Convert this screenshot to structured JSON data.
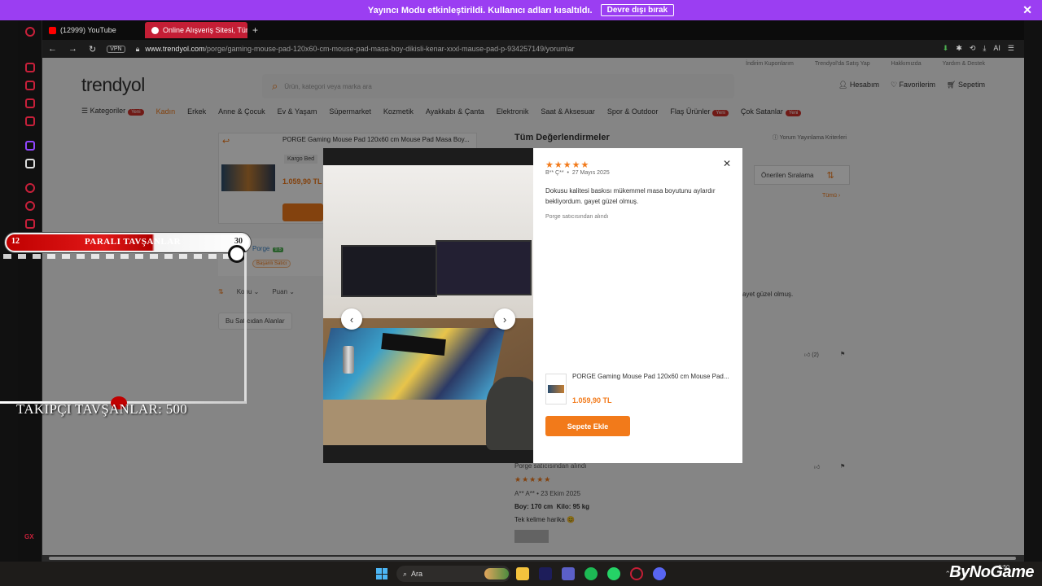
{
  "banner": {
    "text": "Yayıncı Modu etkinleştirildi. Kullanıcı adları kısaltıldı.",
    "button": "Devre dışı bırak",
    "close": "✕"
  },
  "tabs": [
    {
      "label": "(12999) YouTube"
    },
    {
      "label": "Online Alışveriş Sitesi, Tür"
    }
  ],
  "addtab": "+",
  "url": {
    "vpn": "VPN",
    "host": "www.trendyol.com",
    "path": "/porge/gaming-mouse-pad-120x60-cm-mouse-pad-masa-boy-dikisli-kenar-xxxl-mause-pad-p-934257149/yorumlar"
  },
  "toolbar": {
    "ai": "AI"
  },
  "site": {
    "topstrip": [
      "İndirim Kuponlarım",
      "Trendyol'da Satış Yap",
      "Hakkımızda",
      "Yardım & Destek"
    ],
    "logo": "trendyol",
    "search_placeholder": "Ürün, kategori veya marka ara",
    "account": {
      "login": "Hesabım",
      "fav": "Favorilerim",
      "cart": "Sepetim"
    },
    "nav": [
      "Kategoriler",
      "Kadın",
      "Erkek",
      "Anne & Çocuk",
      "Ev & Yaşam",
      "Süpermarket",
      "Kozmetik",
      "Ayakkabı & Çanta",
      "Elektronik",
      "Saat & Aksesuar",
      "Spor & Outdoor",
      "Flaş Ürünler",
      "Çok Satanlar"
    ],
    "yeni": "Yeni",
    "product": {
      "title": "PORGE Gaming Mouse Pad 120x60 cm Mouse Pad Masa Boy...",
      "cargo": "Kargo Bed",
      "price": "1.059,90 TL"
    },
    "seller": {
      "name": "Porge",
      "score": "9.6",
      "badge": "Başarılı Satıcı"
    },
    "filters": [
      "Konu",
      "Puan"
    ],
    "tag": "Bu Satıcıdan Alanlar",
    "reviews_title": "Tüm Değerlendirmeler",
    "criteria": "Yorum Yayınlama Kriterleri",
    "sort": "Önerilen Sıralama",
    "all": "Tümü",
    "bg_review_text": "ayet güzel olmuş.",
    "likes": "(2)",
    "review2": {
      "seller": "Porge satıcısından alındı",
      "stars": "★★★★★",
      "user": "A** A**",
      "date": "23 Ekim 2025",
      "height": "Boy: 170 cm",
      "weight": "Kilo: 95 kg",
      "text": "Tek kelime harika 😊"
    }
  },
  "modal": {
    "stars": "★★★★★",
    "user": "B** Ç**",
    "date": "27 Mayıs 2025",
    "text": "Dokusu kalitesi baskısı mükemmel masa boyutunu aylardır bekliyordum. gayet güzel olmuş.",
    "seller": "Porge satıcısından alındı",
    "product_title": "PORGE Gaming Mouse Pad 120x60 cm Mouse Pad...",
    "price": "1.059,90 TL",
    "cart_button": "Sepete Ekle",
    "prev": "‹",
    "next": "›",
    "close": "✕"
  },
  "stream": {
    "left": "12",
    "title": "PARALI TAVŞANLAR",
    "right": "30",
    "followers": "TAKIPÇI TAVŞANLAR: 500"
  },
  "taskbar": {
    "search": "Ara",
    "brand": "ByNoGame",
    "clock": "2:50"
  },
  "colors": {
    "accent": "#f27a1a",
    "banner": "#9b3ef2",
    "browser_red": "#c41e35"
  }
}
